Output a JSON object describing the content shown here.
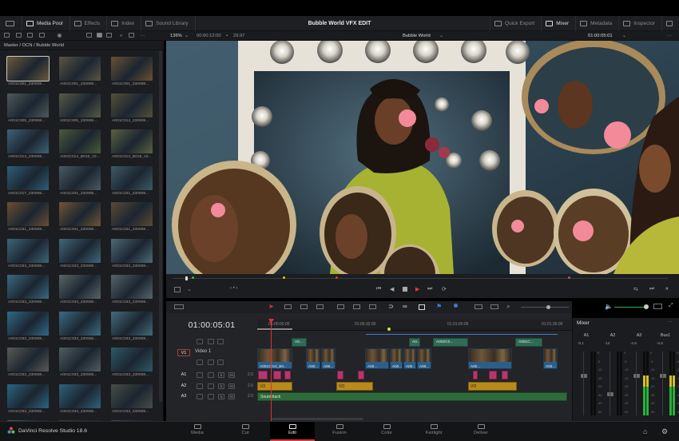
{
  "toolbar": {
    "panels_left": [
      {
        "label": "Media Pool",
        "icon": "media-pool-icon",
        "on": true
      },
      {
        "label": "Effects",
        "icon": "effects-icon",
        "on": false
      },
      {
        "label": "Index",
        "icon": "index-icon",
        "on": false
      },
      {
        "label": "Sound Library",
        "icon": "sound-library-icon",
        "on": false
      }
    ],
    "project_title": "Bubble World VFX EDIT",
    "panels_right": [
      {
        "label": "Quick Export",
        "icon": "quick-export-icon",
        "on": false
      },
      {
        "label": "Mixer",
        "icon": "mixer-icon",
        "on": true
      },
      {
        "label": "Metadata",
        "icon": "metadata-icon",
        "on": false
      },
      {
        "label": "Inspector",
        "icon": "inspector-icon",
        "on": false
      }
    ]
  },
  "viewer_bar": {
    "zoom": "136%",
    "duration": "00:00:12:00",
    "fps": "29.97",
    "clip_name": "Bubble World",
    "timecode": "01:00:05:01"
  },
  "media_pool": {
    "path": "Master / OCN / Bubble World",
    "clips": [
      {
        "name": "A001C001_230908...",
        "color": "#6b5a3c"
      },
      {
        "name": "A001C001_230908...",
        "color": "#5c5544"
      },
      {
        "name": "A001C001_230908...",
        "color": "#6a5232"
      },
      {
        "name": "A001C005_230908...",
        "color": "#4f5a5a"
      },
      {
        "name": "A001C005_230908...",
        "color": "#585a48"
      },
      {
        "name": "A001C014_230908...",
        "color": "#55503a"
      },
      {
        "name": "A001C014_230908...",
        "color": "#3f6276"
      },
      {
        "name": "A001C014_B018_10...",
        "color": "#4a5a3a"
      },
      {
        "name": "A001C014_B018_10...",
        "color": "#5a6240"
      },
      {
        "name": "A001C017_230908...",
        "color": "#2f5f78"
      },
      {
        "name": "A001C031_230908...",
        "color": "#4a5a62"
      },
      {
        "name": "A001C031_230908...",
        "color": "#3f5a66"
      },
      {
        "name": "A001C031_230908...",
        "color": "#6a4f34"
      },
      {
        "name": "A001C031_230908...",
        "color": "#6e5538"
      },
      {
        "name": "A001C031_230908...",
        "color": "#5b4a36"
      },
      {
        "name": "A001C033_230908...",
        "color": "#3e6678"
      },
      {
        "name": "A001C033_230908...",
        "color": "#42677a"
      },
      {
        "name": "A001C033_230908...",
        "color": "#4d6a76"
      },
      {
        "name": "A001C033_230908...",
        "color": "#3b6a82"
      },
      {
        "name": "A001C033_230908...",
        "color": "#5a6466"
      },
      {
        "name": "A001C033_230908...",
        "color": "#55656a"
      },
      {
        "name": "A001C033_230908...",
        "color": "#2f6a88"
      },
      {
        "name": "A001C033_230908...",
        "color": "#3a6c84"
      },
      {
        "name": "A001C033_230908...",
        "color": "#446a7c"
      },
      {
        "name": "A001C033_230908...",
        "color": "#5a5a54"
      },
      {
        "name": "A001C033_230908...",
        "color": "#4f5e60"
      },
      {
        "name": "A001C033_230908...",
        "color": "#2e5a66"
      },
      {
        "name": "A001C033_230908...",
        "color": "#2c6682"
      },
      {
        "name": "A001C033_230908...",
        "color": "#30627c"
      },
      {
        "name": "A001C033_230908...",
        "color": "#4a4e48"
      },
      {
        "name": "A002C014_230908...",
        "color": "#3a6678"
      },
      {
        "name": "A002C016_230908...",
        "color": "#4a4034"
      },
      {
        "name": "A002C016_230908...",
        "color": "#3c4a58"
      }
    ]
  },
  "timeline": {
    "timecode": "01:00:05:01",
    "ruler": [
      "01:00:00:00",
      "01:00:32:00",
      "01:01:00:00",
      "01:01:36:00"
    ],
    "tracks": {
      "v1": {
        "id": "V1",
        "name": "Video 1"
      },
      "a1": {
        "id": "A1",
        "level": "2.0"
      },
      "a2": {
        "id": "A2",
        "level": "2.0"
      },
      "a3": {
        "id": "A3",
        "level": "2.0"
      }
    },
    "fx_clips": [
      "A0...",
      "A0...",
      "A002C0...",
      "A001C..."
    ],
    "video_clips": [
      "A001C014_B0...",
      "A00...",
      "A00...",
      "A00...",
      "A00...",
      "A00...",
      "A00...",
      "A00...",
      "A00..."
    ],
    "vo_clips": [
      "VO",
      "VO",
      "VO"
    ],
    "soundtrack": "Soundtrack"
  },
  "mixer": {
    "title": "Mixer",
    "channels": [
      {
        "name": "A1",
        "db": "-0.1"
      },
      {
        "name": "A2",
        "db": "-14"
      },
      {
        "name": "A3",
        "db": "-4.6"
      },
      {
        "name": "Bus1",
        "db": "-0.5"
      }
    ],
    "scale": [
      "0",
      "-5",
      "-10",
      "-15",
      "-20",
      "-30",
      "-40",
      "-50"
    ]
  },
  "app_name": "DaVinci Resolve Studio 18.6",
  "pages": [
    {
      "label": "Media",
      "icon": "media-page-icon"
    },
    {
      "label": "Cut",
      "icon": "cut-page-icon"
    },
    {
      "label": "Edit",
      "icon": "edit-page-icon",
      "active": true
    },
    {
      "label": "Fusion",
      "icon": "fusion-page-icon"
    },
    {
      "label": "Color",
      "icon": "color-page-icon"
    },
    {
      "label": "Fairlight",
      "icon": "fairlight-page-icon"
    },
    {
      "label": "Deliver",
      "icon": "deliver-page-icon"
    }
  ]
}
